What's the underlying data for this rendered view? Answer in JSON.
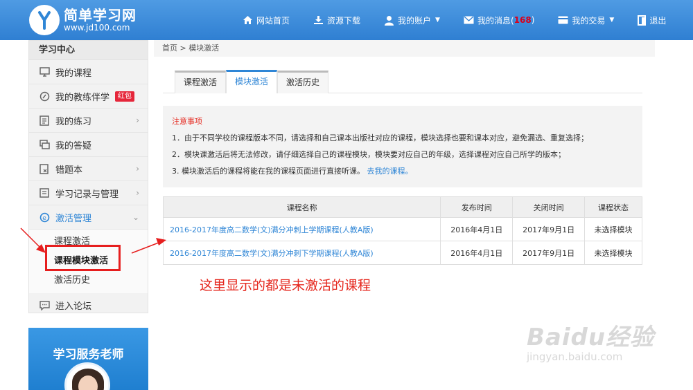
{
  "header": {
    "logo_title": "简单学习网",
    "logo_url": "www.jd100.com",
    "nav": [
      {
        "label": "网站首页",
        "icon": "home-icon"
      },
      {
        "label": "资源下载",
        "icon": "download-icon"
      },
      {
        "label": "我的账户",
        "icon": "user-icon"
      },
      {
        "label": "我的消息(",
        "count": "168",
        "suffix": ")",
        "icon": "mail-icon"
      },
      {
        "label": "我的交易",
        "icon": "card-icon"
      },
      {
        "label": "退出",
        "icon": "exit-icon"
      }
    ]
  },
  "sidebar": {
    "title": "学习中心",
    "items": [
      {
        "label": "我的课程",
        "icon": "monitor-icon"
      },
      {
        "label": "我的教练伴学",
        "icon": "coach-icon",
        "badge": "红包"
      },
      {
        "label": "我的练习",
        "icon": "practice-icon"
      },
      {
        "label": "我的答疑",
        "icon": "qa-icon"
      },
      {
        "label": "错题本",
        "icon": "wrongbook-icon"
      },
      {
        "label": "学习记录与管理",
        "icon": "record-icon"
      },
      {
        "label": "激活管理",
        "icon": "activation-icon"
      },
      {
        "label": "进入论坛",
        "icon": "forum-icon"
      }
    ],
    "sub_items": [
      "课程激活",
      "课程模块激活",
      "激活历史"
    ],
    "service_title": "学习服务老师"
  },
  "breadcrumb": "首页 > 模块激活",
  "tabs": [
    "课程激活",
    "模块激活",
    "激活历史"
  ],
  "notice": {
    "title": "注意事项",
    "line1": "1．由于不同学校的课程版本不同，请选择和自己课本出版社对应的课程，模块选择也要和课本对应，避免漏选、重复选择；",
    "line2": "2．模块课激活后将无法修改，请仔细选择自己的课程模块，模块要对应自己的年级，选择课程对应自己所学的版本；",
    "line3": "3. 模块激活后的课程将能在我的课程页面进行直接听课。",
    "link": "去我的课程。"
  },
  "table": {
    "headers": [
      "课程名称",
      "发布时间",
      "关闭时间",
      "课程状态"
    ],
    "rows": [
      [
        "2016-2017年度高二数学(文)满分冲刺上学期课程(人教A版)",
        "2016年4月1日",
        "2017年9月1日",
        "未选择模块"
      ],
      [
        "2016-2017年度高二数学(文)满分冲刺下学期课程(人教A版)",
        "2016年4月1日",
        "2017年9月1日",
        "未选择模块"
      ]
    ]
  },
  "annotation": "这里显示的都是未激活的课程",
  "watermark": {
    "big": "Baidu经验",
    "small": "jingyan.baidu.com"
  },
  "colors": {
    "header": "#2f7fd2",
    "accent": "#2f86d6",
    "annotation": "#e5261c"
  }
}
